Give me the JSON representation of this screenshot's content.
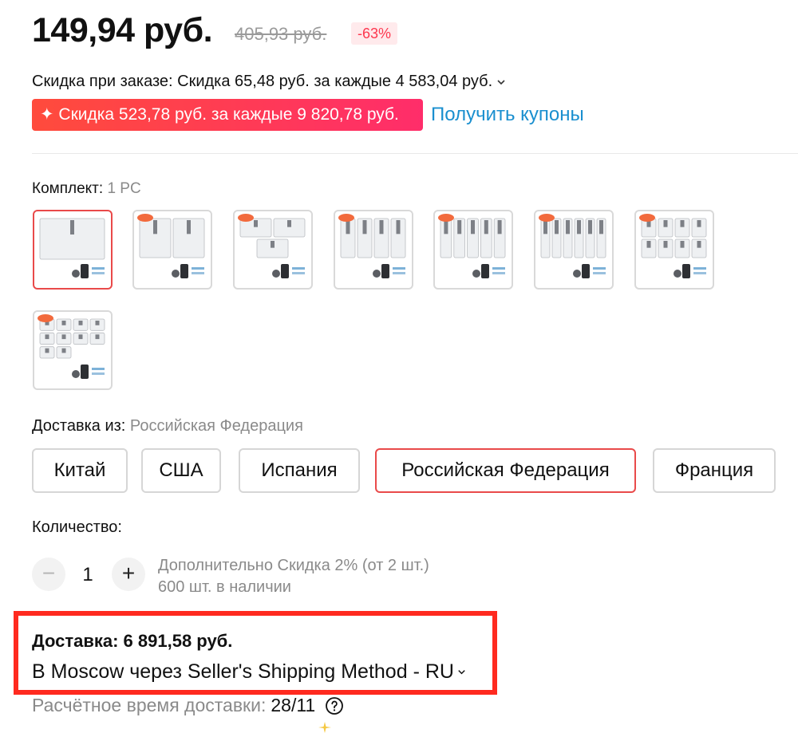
{
  "price": {
    "current": "149,94 руб.",
    "old": "405,93 руб.",
    "discount_badge": "-63%"
  },
  "order_discount": "Скидка при заказе: Скидка 65,48 руб. за каждые 4 583,04 руб.",
  "coupon": {
    "badge": "✦ Скидка 523,78 руб. за каждые 9 820,78 руб.",
    "link": "Получить купоны"
  },
  "set": {
    "label": "Комплект:",
    "value": "1 PC",
    "selected_index": 0
  },
  "shipping_from": {
    "label": "Доставка из:",
    "value": "Российская Федерация",
    "options": [
      "Китай",
      "США",
      "Испания",
      "Российская Федерация",
      "Франция"
    ],
    "selected_index": 3
  },
  "quantity": {
    "label": "Количество:",
    "value": "1",
    "minus": "−",
    "plus": "+",
    "note_line1": "Дополнительно Скидка 2% (от 2 шт.)",
    "note_line2": "600 шт. в наличии"
  },
  "delivery": {
    "cost": "Доставка: 6 891,58 руб.",
    "method": "В Moscow через Seller's Shipping Method - RU",
    "eta_label": "Расчётное время доставки:",
    "eta_date": "28/11"
  },
  "colors": {
    "accent_red": "#e94a4a",
    "coupon_gradient_start": "#ff4b3c",
    "coupon_gradient_end": "#ff2d6a",
    "link_blue": "#1a8fcf",
    "highlight_box": "#ff2a1f"
  },
  "icons": [
    "chevron-down-icon",
    "sparkle-icon",
    "minus-icon",
    "plus-icon",
    "help-circle-icon"
  ]
}
